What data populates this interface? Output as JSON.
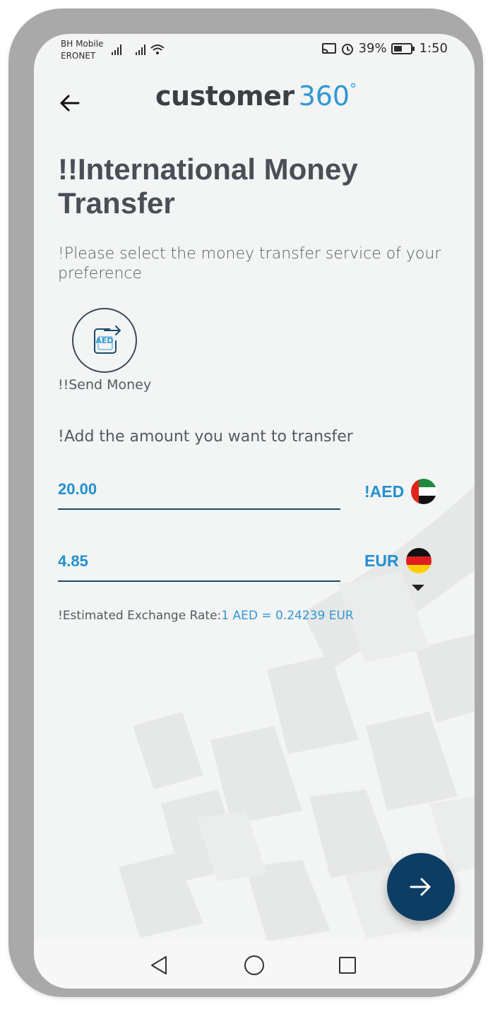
{
  "status_bar": {
    "carrier_line1": "BH Mobile",
    "carrier_line2": "ERONET",
    "battery": "39%",
    "time": "1:50"
  },
  "header": {
    "logo_main": "customer",
    "logo_accent": "360",
    "logo_degree": "°"
  },
  "page": {
    "title": "!!International Money Transfer",
    "subtitle": "!Please select the money transfer service of your preference"
  },
  "service": {
    "icon_text": "AED",
    "label": "!!Send Money"
  },
  "transfer": {
    "prompt": "!Add the amount you want to transfer",
    "from_amount": "20.00",
    "from_currency": "!AED",
    "to_amount": "4.85",
    "to_currency": "EUR",
    "rate_label": "!Estimated Exchange Rate:",
    "rate_value": "1 AED = 0.24239 EUR"
  },
  "colors": {
    "accent": "#2390cf",
    "fab": "#0d3d63",
    "title": "#4a4f57"
  },
  "icons": [
    "back-arrow-icon",
    "send-money-icon",
    "uae-flag-icon",
    "germany-flag-icon",
    "dropdown-caret-icon",
    "next-arrow-icon",
    "nav-back-icon",
    "nav-home-icon",
    "nav-recents-icon"
  ]
}
